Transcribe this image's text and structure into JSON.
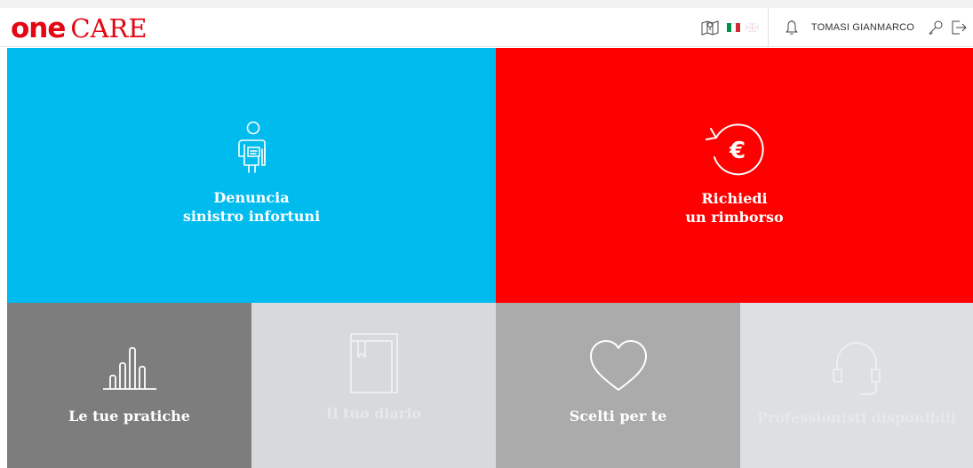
{
  "header": {
    "logo_one": "one",
    "logo_care": "CARE",
    "user_name": "TOMASI GIANMARCO",
    "icons": [
      "map-icon",
      "flag-it-icon",
      "flag-uk-icon",
      "bell-icon",
      "key-icon",
      "logout-icon"
    ]
  },
  "tiles": [
    {
      "line1": "Denuncia",
      "line2": "sinistro infortuni",
      "icon": "injured-person-icon",
      "color": "#00bcee"
    },
    {
      "line1": "Richiedi",
      "line2": "un rimborso",
      "icon": "euro-refund-icon",
      "color": "#ff0000"
    },
    {
      "label": "Le tue pratiche",
      "icon": "bar-chart-icon",
      "color": "#7d7d7d"
    },
    {
      "label": "Il tuo diario",
      "icon": "diary-book-icon",
      "color": "#d7dadd",
      "state": "disabled"
    },
    {
      "label": "Scelti per te",
      "icon": "heart-icon",
      "color": "#ababab"
    },
    {
      "label": "Professionisti disponibili",
      "icon": "headset-icon",
      "color": "#dde0e3",
      "state": "disabled"
    }
  ],
  "colors": {
    "brand_red": "#e30613",
    "accent_blue": "#00bcee"
  }
}
